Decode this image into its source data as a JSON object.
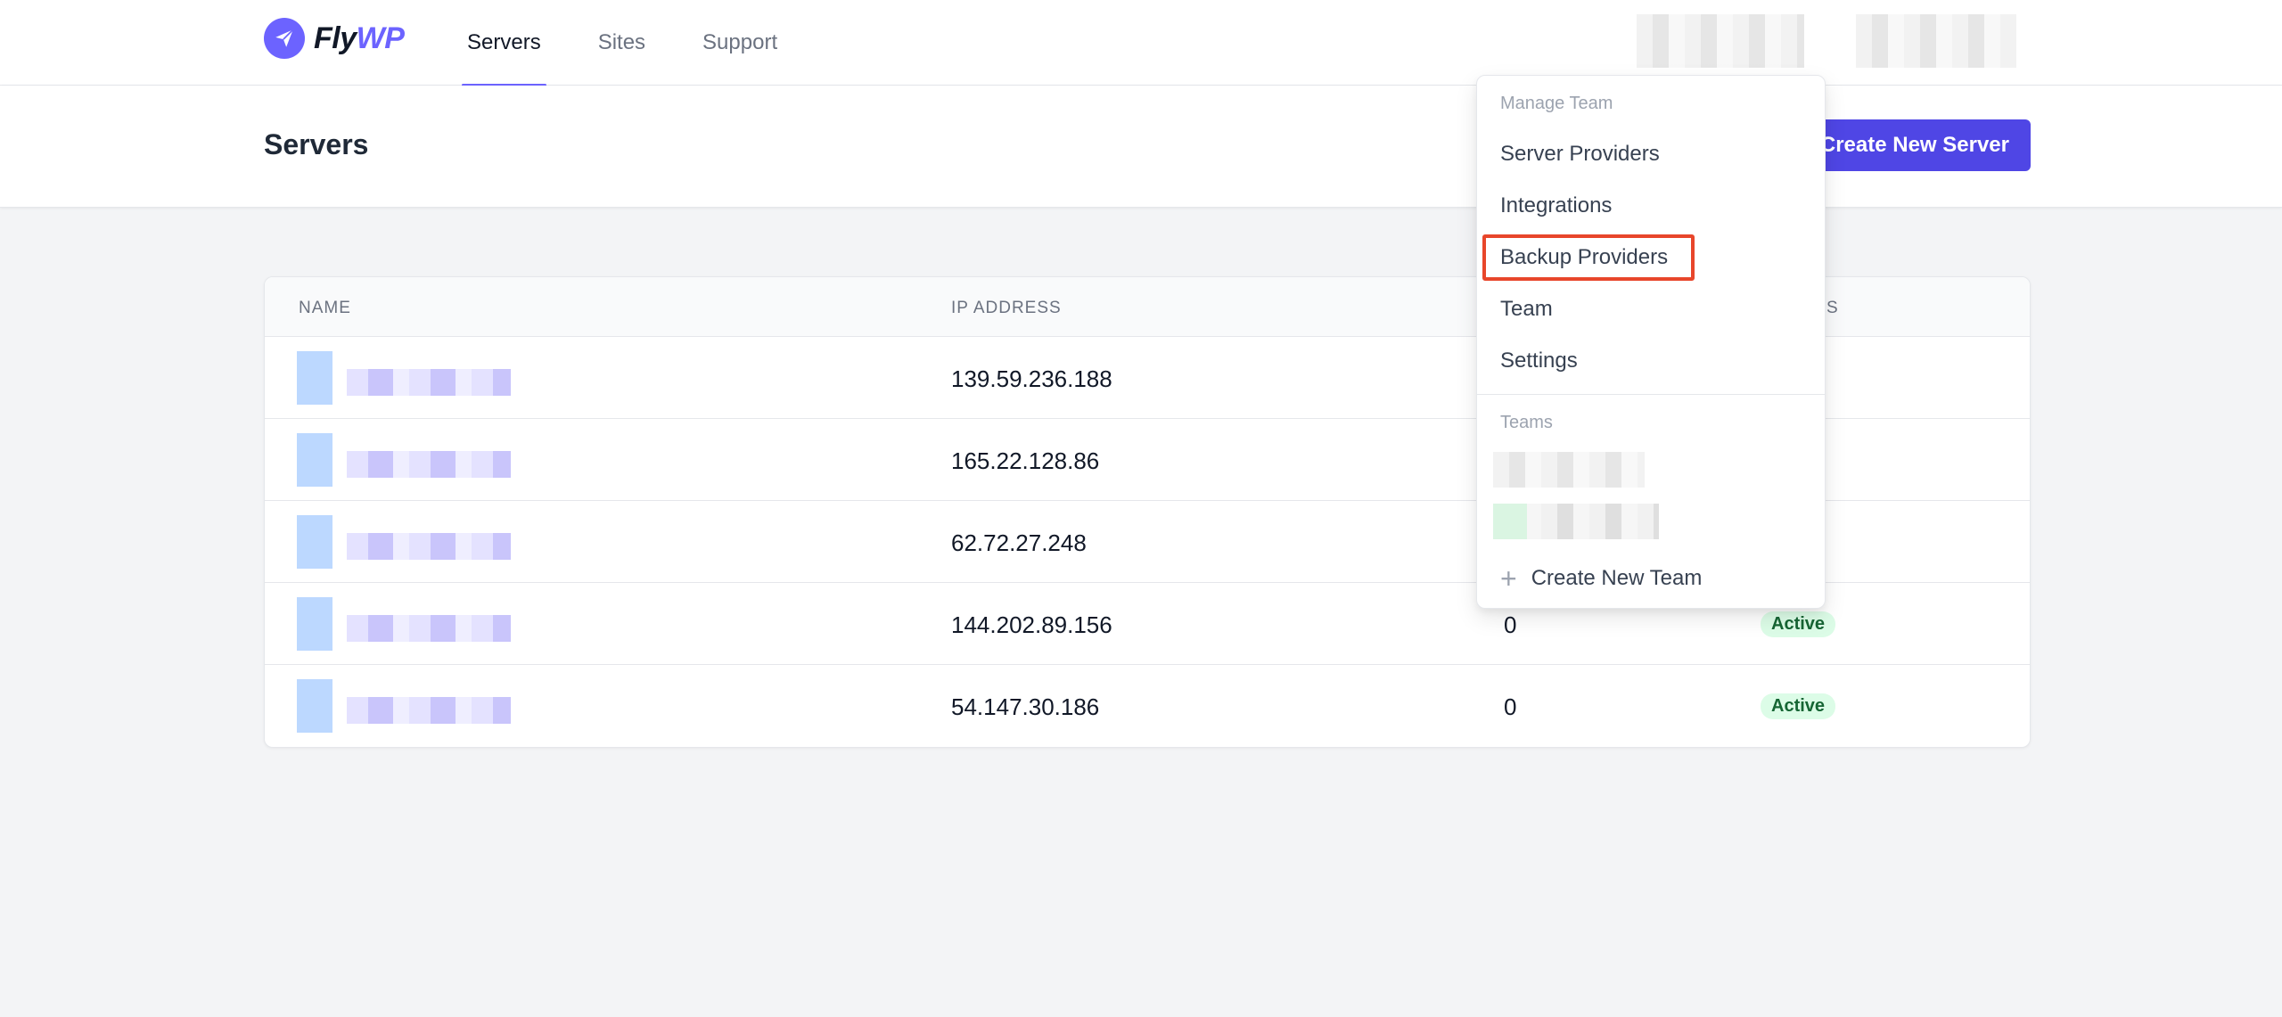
{
  "brand": {
    "name_part1": "Fly",
    "name_part2": "WP",
    "accent": "#6c63ff"
  },
  "nav": {
    "items": [
      {
        "label": "Servers",
        "active": true
      },
      {
        "label": "Sites",
        "active": false
      },
      {
        "label": "Support",
        "active": false
      }
    ]
  },
  "header": {
    "title": "Servers",
    "create_button": "Create New Server",
    "button_color": "#4f46e5"
  },
  "table": {
    "columns": {
      "name": "NAME",
      "ip": "IP ADDRESS",
      "status_partial": "S"
    },
    "rows": [
      {
        "ip": "139.59.236.188",
        "sites": "",
        "status": ""
      },
      {
        "ip": "165.22.128.86",
        "sites": "",
        "status": ""
      },
      {
        "ip": "62.72.27.248",
        "sites": "",
        "status": ""
      },
      {
        "ip": "144.202.89.156",
        "sites": "0",
        "status": "Active"
      },
      {
        "ip": "54.147.30.186",
        "sites": "0",
        "status": "Active"
      }
    ]
  },
  "dropdown": {
    "manage_heading": "Manage Team",
    "items": [
      {
        "label": "Server Providers"
      },
      {
        "label": "Integrations"
      },
      {
        "label": "Backup Providers",
        "highlighted": true
      },
      {
        "label": "Team"
      },
      {
        "label": "Settings"
      }
    ],
    "teams_heading": "Teams",
    "create_team": "Create New Team",
    "highlight_color": "#e8462b"
  },
  "status_colors": {
    "active_bg": "#dcfce7",
    "active_text": "#166534"
  }
}
